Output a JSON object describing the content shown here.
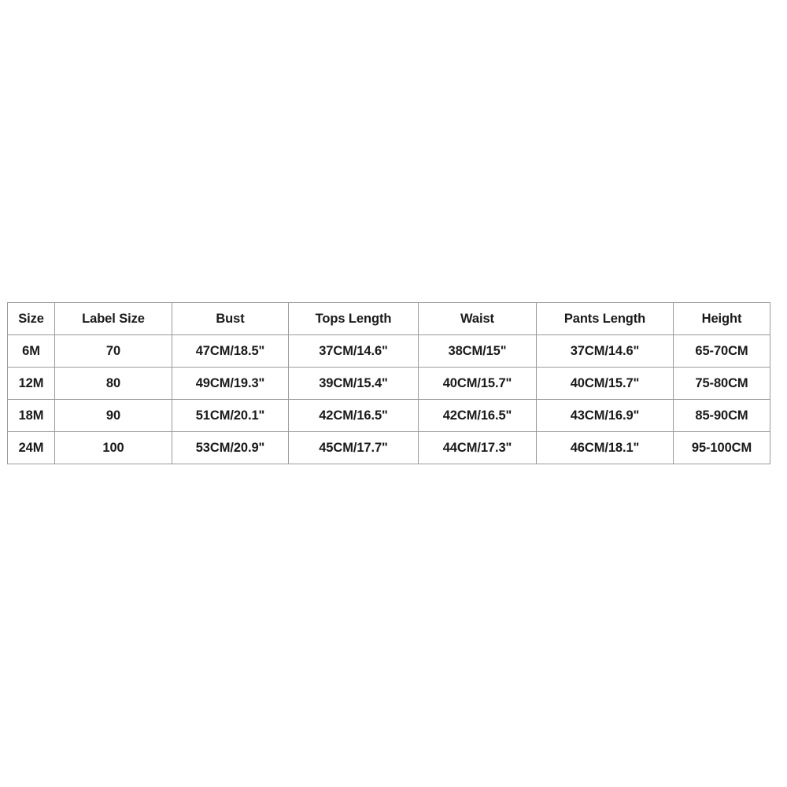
{
  "table": {
    "name": "size-chart",
    "border_color": "#9a9a9a",
    "background": "#ffffff",
    "text_color": "#1a1a1a",
    "columns": [
      "Size",
      "Label Size",
      "Bust",
      "Tops Length",
      "Waist",
      "Pants Length",
      "Height"
    ],
    "rows": [
      {
        "size": "6M",
        "label_size": "70",
        "bust": "47CM/18.5\"",
        "tops_length": "37CM/14.6\"",
        "waist": "38CM/15\"",
        "pants_length": "37CM/14.6\"",
        "height": "65-70CM"
      },
      {
        "size": "12M",
        "label_size": "80",
        "bust": "49CM/19.3\"",
        "tops_length": "39CM/15.4\"",
        "waist": "40CM/15.7\"",
        "pants_length": "40CM/15.7\"",
        "height": "75-80CM"
      },
      {
        "size": "18M",
        "label_size": "90",
        "bust": "51CM/20.1\"",
        "tops_length": "42CM/16.5\"",
        "waist": "42CM/16.5\"",
        "pants_length": "43CM/16.9\"",
        "height": "85-90CM"
      },
      {
        "size": "24M",
        "label_size": "100",
        "bust": "53CM/20.9\"",
        "tops_length": "45CM/17.7\"",
        "waist": "44CM/17.3\"",
        "pants_length": "46CM/18.1\"",
        "height": "95-100CM"
      }
    ]
  }
}
